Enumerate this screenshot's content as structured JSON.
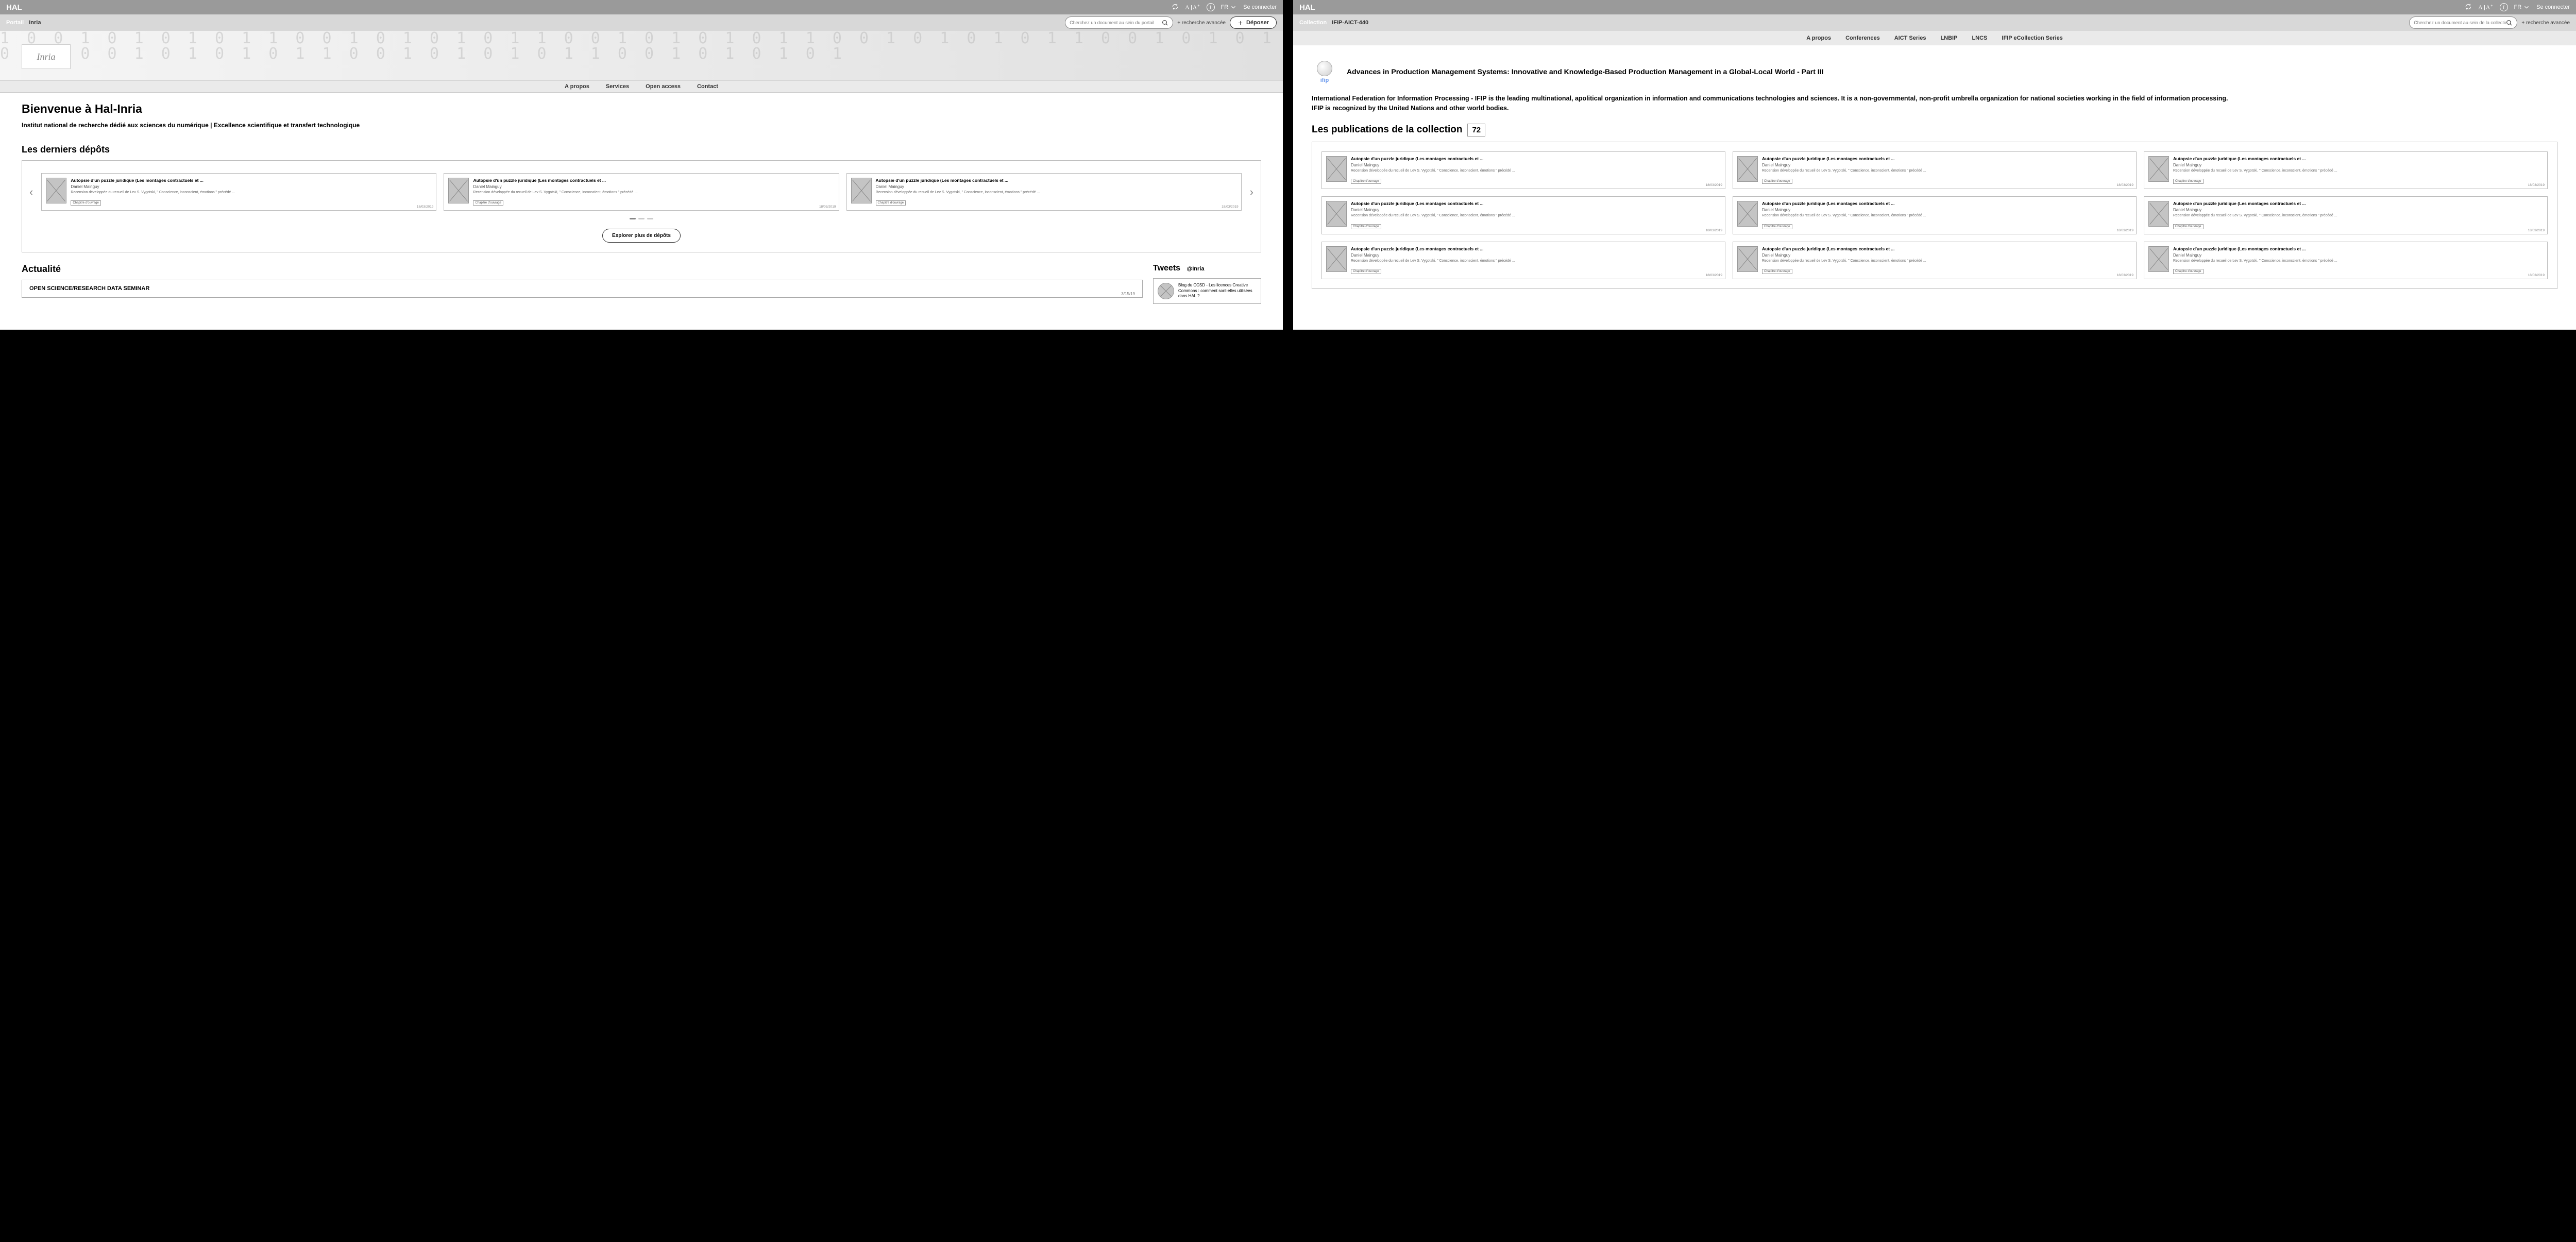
{
  "topbar": {
    "logo": "HAL",
    "lang": "FR",
    "login": "Se connecter"
  },
  "left": {
    "portal_label": "Portail",
    "portal_name": "Inria",
    "search_placeholder": "Cherchez un document au sein du portail",
    "adv_search": "+ recherche avancée",
    "deposit": "Déposer",
    "inria_logo": "Inria",
    "nav": [
      "A propos",
      "Services",
      "Open access",
      "Contact"
    ],
    "welcome": "Bienvenue à Hal-Inria",
    "subtitle": "Institut national de recherche dédié aux sciences du numérique | Excellence scientifique et transfert technologique",
    "latest_title": "Les derniers dépôts",
    "card": {
      "title": "Autopsie d'un puzzle juridique (Les montages contractuels et ...",
      "author": "Daniel Mainguy",
      "desc": "Recension développée du recueil de Lev S. Vygotski, \" Conscience, inconscient, émotions \" précédé ...",
      "tag": "Chapitre d'ouvrage",
      "date": "18/03/2019"
    },
    "explore": "Explorer plus de dépôts",
    "news_heading": "Actualité",
    "news_item": "OPEN SCIENCE/RESEARCH DATA SEMINAR",
    "news_date": "3/15/19",
    "tweets_heading": "Tweets",
    "tweets_handle": "@Inria",
    "tweet_text": "Blog du CCSD - Les licences Creative Commons : comment sont-elles utilisées dans HAL ?"
  },
  "right": {
    "coll_label": "Collection",
    "coll_name": "IFIP-AICT-440",
    "search_placeholder": "Cherchez un document au sein de la collection",
    "adv_search": "+ recherche avancée",
    "nav": [
      "A propos",
      "Conferences",
      "AICT Series",
      "LNBIP",
      "LNCS",
      "IFIP eCollection Series"
    ],
    "ifip": "ifip",
    "coll_title": "Advances in Production Management Systems: Innovative and Knowledge-Based Production Management in a Global-Local World - Part III",
    "desc1": "International Federation for Information Processing - IFIP is the leading multinational, apolitical organization in information and communications technologies and sciences. It is a non-governmental, non-profit umbrella organization for national societies working in the field of information processing.",
    "desc2": "IFIP is recognized by the United Nations and other world bodies.",
    "pub_title": "Les publications de la collection",
    "pub_count": "72"
  }
}
